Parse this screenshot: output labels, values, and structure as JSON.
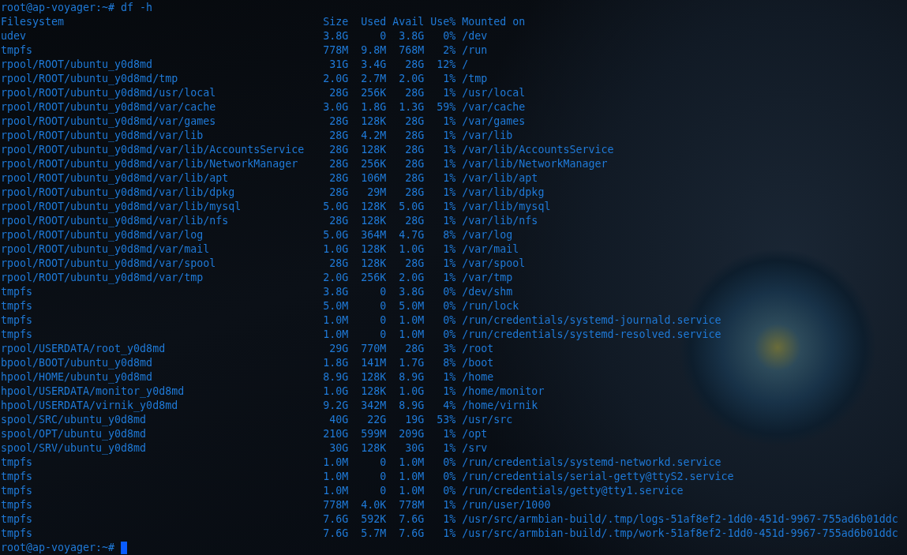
{
  "terminal": {
    "command_line": "root@ap-voyager:~# df -h",
    "columns": [
      "Filesystem",
      "Size",
      "Used",
      "Avail",
      "Use%",
      "Mounted on"
    ],
    "rows": [
      [
        "udev",
        "3.8G",
        "0",
        "3.8G",
        "0%",
        "/dev"
      ],
      [
        "tmpfs",
        "778M",
        "9.8M",
        "768M",
        "2%",
        "/run"
      ],
      [
        "rpool/ROOT/ubuntu_y0d8md",
        "31G",
        "3.4G",
        "28G",
        "12%",
        "/"
      ],
      [
        "rpool/ROOT/ubuntu_y0d8md/tmp",
        "2.0G",
        "2.7M",
        "2.0G",
        "1%",
        "/tmp"
      ],
      [
        "rpool/ROOT/ubuntu_y0d8md/usr/local",
        "28G",
        "256K",
        "28G",
        "1%",
        "/usr/local"
      ],
      [
        "rpool/ROOT/ubuntu_y0d8md/var/cache",
        "3.0G",
        "1.8G",
        "1.3G",
        "59%",
        "/var/cache"
      ],
      [
        "rpool/ROOT/ubuntu_y0d8md/var/games",
        "28G",
        "128K",
        "28G",
        "1%",
        "/var/games"
      ],
      [
        "rpool/ROOT/ubuntu_y0d8md/var/lib",
        "28G",
        "4.2M",
        "28G",
        "1%",
        "/var/lib"
      ],
      [
        "rpool/ROOT/ubuntu_y0d8md/var/lib/AccountsService",
        "28G",
        "128K",
        "28G",
        "1%",
        "/var/lib/AccountsService"
      ],
      [
        "rpool/ROOT/ubuntu_y0d8md/var/lib/NetworkManager",
        "28G",
        "256K",
        "28G",
        "1%",
        "/var/lib/NetworkManager"
      ],
      [
        "rpool/ROOT/ubuntu_y0d8md/var/lib/apt",
        "28G",
        "106M",
        "28G",
        "1%",
        "/var/lib/apt"
      ],
      [
        "rpool/ROOT/ubuntu_y0d8md/var/lib/dpkg",
        "28G",
        "29M",
        "28G",
        "1%",
        "/var/lib/dpkg"
      ],
      [
        "rpool/ROOT/ubuntu_y0d8md/var/lib/mysql",
        "5.0G",
        "128K",
        "5.0G",
        "1%",
        "/var/lib/mysql"
      ],
      [
        "rpool/ROOT/ubuntu_y0d8md/var/lib/nfs",
        "28G",
        "128K",
        "28G",
        "1%",
        "/var/lib/nfs"
      ],
      [
        "rpool/ROOT/ubuntu_y0d8md/var/log",
        "5.0G",
        "364M",
        "4.7G",
        "8%",
        "/var/log"
      ],
      [
        "rpool/ROOT/ubuntu_y0d8md/var/mail",
        "1.0G",
        "128K",
        "1.0G",
        "1%",
        "/var/mail"
      ],
      [
        "rpool/ROOT/ubuntu_y0d8md/var/spool",
        "28G",
        "128K",
        "28G",
        "1%",
        "/var/spool"
      ],
      [
        "rpool/ROOT/ubuntu_y0d8md/var/tmp",
        "2.0G",
        "256K",
        "2.0G",
        "1%",
        "/var/tmp"
      ],
      [
        "tmpfs",
        "3.8G",
        "0",
        "3.8G",
        "0%",
        "/dev/shm"
      ],
      [
        "tmpfs",
        "5.0M",
        "0",
        "5.0M",
        "0%",
        "/run/lock"
      ],
      [
        "tmpfs",
        "1.0M",
        "0",
        "1.0M",
        "0%",
        "/run/credentials/systemd-journald.service"
      ],
      [
        "tmpfs",
        "1.0M",
        "0",
        "1.0M",
        "0%",
        "/run/credentials/systemd-resolved.service"
      ],
      [
        "rpool/USERDATA/root_y0d8md",
        "29G",
        "770M",
        "28G",
        "3%",
        "/root"
      ],
      [
        "bpool/BOOT/ubuntu_y0d8md",
        "1.8G",
        "141M",
        "1.7G",
        "8%",
        "/boot"
      ],
      [
        "hpool/HOME/ubuntu_y0d8md",
        "8.9G",
        "128K",
        "8.9G",
        "1%",
        "/home"
      ],
      [
        "hpool/USERDATA/monitor_y0d8md",
        "1.0G",
        "128K",
        "1.0G",
        "1%",
        "/home/monitor"
      ],
      [
        "hpool/USERDATA/virnik_y0d8md",
        "9.2G",
        "342M",
        "8.9G",
        "4%",
        "/home/virnik"
      ],
      [
        "spool/SRC/ubuntu_y0d8md",
        "40G",
        "22G",
        "19G",
        "53%",
        "/usr/src"
      ],
      [
        "spool/OPT/ubuntu_y0d8md",
        "210G",
        "599M",
        "209G",
        "1%",
        "/opt"
      ],
      [
        "spool/SRV/ubuntu_y0d8md",
        "30G",
        "128K",
        "30G",
        "1%",
        "/srv"
      ],
      [
        "tmpfs",
        "1.0M",
        "0",
        "1.0M",
        "0%",
        "/run/credentials/systemd-networkd.service"
      ],
      [
        "tmpfs",
        "1.0M",
        "0",
        "1.0M",
        "0%",
        "/run/credentials/serial-getty@ttyS2.service"
      ],
      [
        "tmpfs",
        "1.0M",
        "0",
        "1.0M",
        "0%",
        "/run/credentials/getty@tty1.service"
      ],
      [
        "tmpfs",
        "778M",
        "4.0K",
        "778M",
        "1%",
        "/run/user/1000"
      ],
      [
        "tmpfs",
        "7.6G",
        "592K",
        "7.6G",
        "1%",
        "/usr/src/armbian-build/.tmp/logs-51af8ef2-1dd0-451d-9967-755ad6b01ddc"
      ],
      [
        "tmpfs",
        "7.6G",
        "5.7M",
        "7.6G",
        "1%",
        "/usr/src/armbian-build/.tmp/work-51af8ef2-1dd0-451d-9967-755ad6b01ddc"
      ]
    ],
    "prompt": "root@ap-voyager:~#"
  }
}
